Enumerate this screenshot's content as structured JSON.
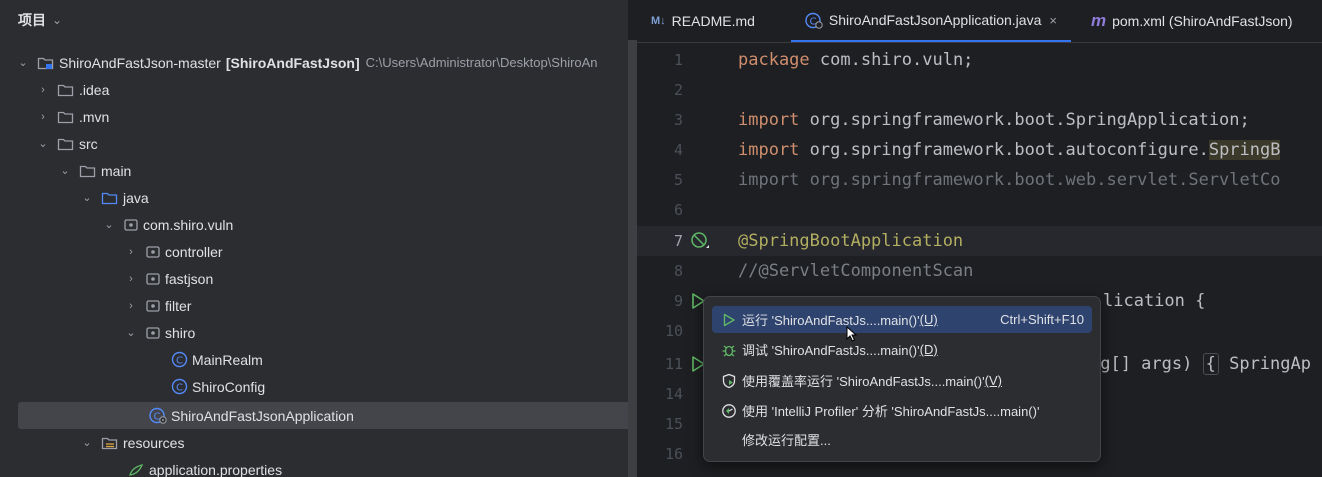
{
  "project_panel": {
    "title": "项目",
    "tree": [
      {
        "label": "ShiroAndFastJson-master",
        "module": "[ShiroAndFastJson]",
        "path": "C:\\Users\\Administrator\\Desktop\\ShiroAn",
        "expanded": true,
        "icon": "module-folder-icon"
      },
      {
        "label": ".idea",
        "expanded": false,
        "icon": "folder-icon"
      },
      {
        "label": ".mvn",
        "expanded": false,
        "icon": "folder-icon"
      },
      {
        "label": "src",
        "expanded": true,
        "icon": "folder-icon"
      },
      {
        "label": "main",
        "expanded": true,
        "icon": "folder-icon"
      },
      {
        "label": "java",
        "expanded": true,
        "icon": "source-folder-icon"
      },
      {
        "label": "com.shiro.vuln",
        "expanded": true,
        "icon": "package-icon"
      },
      {
        "label": "controller",
        "expanded": false,
        "icon": "package-icon"
      },
      {
        "label": "fastjson",
        "expanded": false,
        "icon": "package-icon"
      },
      {
        "label": "filter",
        "expanded": false,
        "icon": "package-icon"
      },
      {
        "label": "shiro",
        "expanded": true,
        "icon": "package-icon"
      },
      {
        "label": "MainRealm",
        "icon": "class-icon"
      },
      {
        "label": "ShiroConfig",
        "icon": "class-icon"
      },
      {
        "label": "ShiroAndFastJsonApplication",
        "icon": "spring-boot-class-icon",
        "selected": true
      },
      {
        "label": "resources",
        "expanded": true,
        "icon": "resources-folder-icon"
      },
      {
        "label": "application.properties",
        "icon": "properties-file-icon"
      }
    ]
  },
  "editor": {
    "tabs": [
      {
        "label": "README.md",
        "prefix": "M↓",
        "active": false
      },
      {
        "label": "ShiroAndFastJsonApplication.java",
        "active": true,
        "close": "×"
      },
      {
        "label": "pom.xml (ShiroAndFastJson)",
        "prefix": "m",
        "active": false
      }
    ],
    "line_numbers": [
      "1",
      "2",
      "3",
      "4",
      "5",
      "6",
      "7",
      "8",
      "9",
      "10",
      "11",
      "14",
      "15",
      "16"
    ],
    "lines": {
      "l1_kw": "package",
      "l1_rest": " com.shiro.vuln;",
      "l3_kw": "import",
      "l3_rest": " org.springframework.boot.SpringApplication;",
      "l4_kw": "import",
      "l4_rest": " org.springframework.boot.autoconfigure.",
      "l4_hl": "SpringB",
      "l5": "import org.springframework.boot.web.servlet.ServletCo",
      "l7": "@SpringBootApplication",
      "l8": "//@ServletComponentScan",
      "l9_tail": "lication {",
      "l11_tail": "ng[] args)",
      "l11_brace": "{",
      "l11_end": " SpringAp"
    }
  },
  "run_menu": {
    "items": [
      {
        "icon": "run-icon",
        "label": "运行 'ShiroAndFastJs....main()'",
        "mnemonic": "(U)",
        "shortcut": "Ctrl+Shift+F10",
        "active": true
      },
      {
        "icon": "debug-icon",
        "label": "调试 'ShiroAndFastJs....main()'",
        "mnemonic": "(D)"
      },
      {
        "icon": "coverage-icon",
        "label": "使用覆盖率运行 'ShiroAndFastJs....main()'",
        "mnemonic": "(V)"
      },
      {
        "icon": "profiler-icon",
        "label": "使用 'IntelliJ Profiler' 分析  'ShiroAndFastJs....main()'"
      },
      {
        "icon": "",
        "label": "修改运行配置..."
      }
    ]
  },
  "colors": {
    "background": "#1e1f22",
    "panel": "#2b2d30",
    "accent": "#3574f0",
    "run_green": "#5fb865",
    "keyword": "#cf8e6d",
    "annotation": "#b3ae60"
  }
}
